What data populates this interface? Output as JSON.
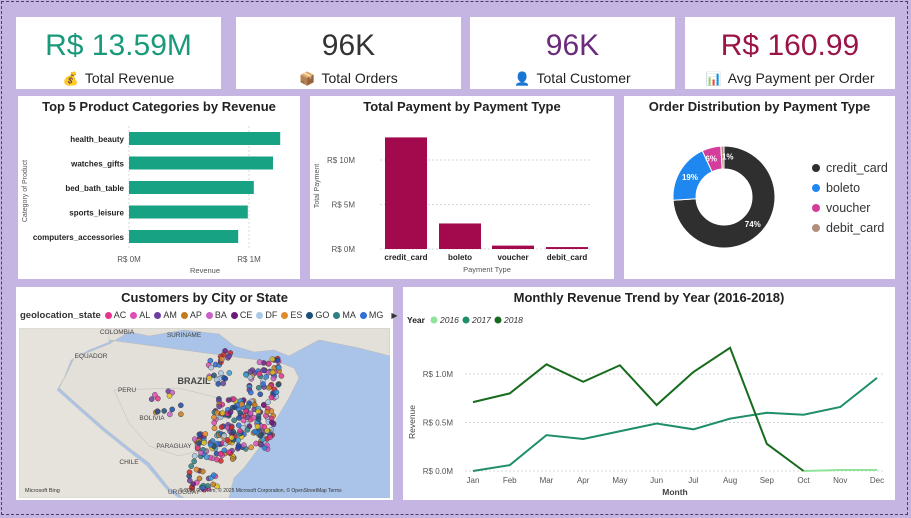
{
  "kpis": [
    {
      "value": "R$ 13.59M",
      "label": "Total Revenue",
      "icon": "money-bag-icon",
      "glyph": "💰",
      "color": "#1a9a7a"
    },
    {
      "value": "96K",
      "label": "Total Orders",
      "icon": "package-icon",
      "glyph": "📦",
      "color": "#333333"
    },
    {
      "value": "96K",
      "label": "Total Customer",
      "icon": "person-icon",
      "glyph": "👤",
      "color": "#6a2b7a"
    },
    {
      "value": "R$ 160.99",
      "label": "Avg Payment per Order",
      "icon": "bar-chart-icon",
      "glyph": "📊",
      "color": "#9b1448"
    }
  ],
  "chart_data": [
    {
      "type": "bar",
      "title": "Top 5 Product Categories by Revenue",
      "orientation": "horizontal",
      "categories": [
        "health_beauty",
        "watches_gifts",
        "bed_bath_table",
        "sports_leisure",
        "computers_accessories"
      ],
      "values": [
        1.26,
        1.2,
        1.04,
        0.99,
        0.91
      ],
      "unit": "R$ M",
      "xlabel": "Revenue",
      "ylabel": "Category of Product",
      "xticks": [
        "R$ 0M",
        "R$ 1M"
      ],
      "xlim": [
        0,
        1.5
      ],
      "color": "#16a283"
    },
    {
      "type": "bar",
      "title": "Total Payment by Payment Type",
      "categories": [
        "credit_card",
        "boleto",
        "voucher",
        "debit_card"
      ],
      "values": [
        12.54,
        2.87,
        0.38,
        0.22
      ],
      "unit": "R$ M",
      "xlabel": "Payment Type",
      "ylabel": "Total Payment",
      "yticks": [
        "R$ 0M",
        "R$ 5M",
        "R$ 10M"
      ],
      "ylim": [
        0,
        14
      ],
      "color": "#a30a4e"
    },
    {
      "type": "pie",
      "title": "Order Distribution by Payment Type",
      "categories": [
        "credit_card",
        "boleto",
        "voucher",
        "debit_card"
      ],
      "values": [
        74,
        19,
        6,
        1
      ],
      "labels": [
        "74%",
        "19%",
        "6%",
        "1%"
      ],
      "colors": [
        "#2f2f2f",
        "#1e88f0",
        "#d43d9b",
        "#b08f7f"
      ]
    },
    {
      "type": "line",
      "title": "Monthly Revenue Trend by Year (2016-2018)",
      "x": [
        "Jan",
        "Feb",
        "Mar",
        "Apr",
        "May",
        "Jun",
        "Jul",
        "Aug",
        "Sep",
        "Oct",
        "Nov",
        "Dec"
      ],
      "xlabel": "Month",
      "ylabel": "Revenue",
      "yticks": [
        "R$ 0.0M",
        "R$ 0.5M",
        "R$ 1.0M"
      ],
      "ylim": [
        0,
        1.4
      ],
      "legend_title": "Year",
      "series": [
        {
          "name": "2016",
          "color": "#8fe39a",
          "values": [
            null,
            null,
            null,
            null,
            null,
            null,
            null,
            null,
            null,
            0.0,
            0.01,
            0.01
          ]
        },
        {
          "name": "2017",
          "color": "#1f8f67",
          "values": [
            0.0,
            0.06,
            0.37,
            0.33,
            0.41,
            0.49,
            0.43,
            0.54,
            0.6,
            0.58,
            0.66,
            0.96
          ]
        },
        {
          "name": "2018",
          "color": "#166b1d",
          "values": [
            0.71,
            0.8,
            1.1,
            0.92,
            1.09,
            0.68,
            1.02,
            1.27,
            0.28,
            0.0,
            null,
            null
          ]
        }
      ]
    }
  ],
  "map": {
    "title": "Customers by City or State",
    "legend_title": "geolocation_state",
    "states": [
      {
        "code": "AC",
        "color": "#e8338a"
      },
      {
        "code": "AL",
        "color": "#de4fb4"
      },
      {
        "code": "AM",
        "color": "#6b3fa0"
      },
      {
        "code": "AP",
        "color": "#c27c1d"
      },
      {
        "code": "BA",
        "color": "#cc5ec9"
      },
      {
        "code": "CE",
        "color": "#6a1b7a"
      },
      {
        "code": "DF",
        "color": "#aac8e8"
      },
      {
        "code": "ES",
        "color": "#e08a2c"
      },
      {
        "code": "GO",
        "color": "#1d4f78"
      },
      {
        "code": "MA",
        "color": "#2e7f80"
      },
      {
        "code": "MG",
        "color": "#2f6fd8"
      }
    ],
    "labels": [
      "COLOMBIA",
      "SURINAME",
      "EQUADOR",
      "BRAZIL",
      "PERU",
      "BOLIVIA",
      "PARAGUAY",
      "CHILE",
      "URUGUAY"
    ],
    "attribution": "© 2025 TomTom, © 2025 Microsoft Corporation, © OpenStreetMap  Terms",
    "bing_logo": "Microsoft Bing"
  }
}
